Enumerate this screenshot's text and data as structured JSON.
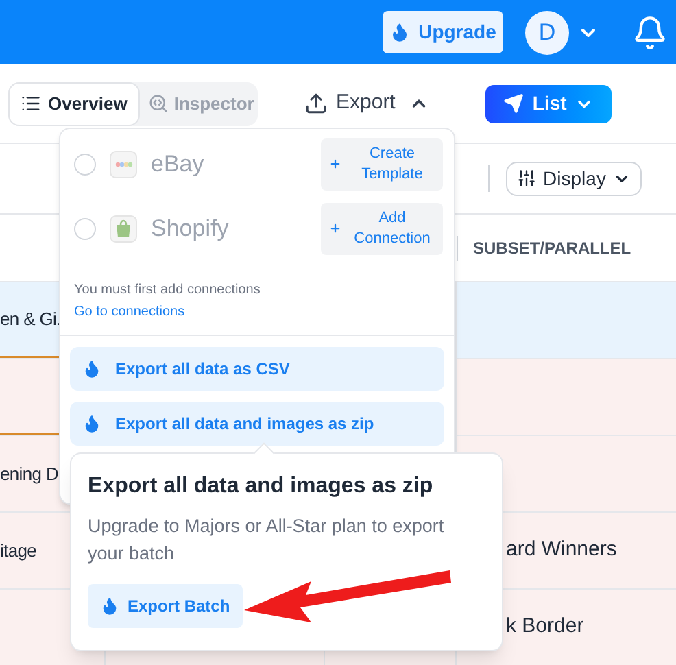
{
  "top_bar": {
    "upgrade": "Upgrade",
    "avatar": "D"
  },
  "view_tabs": [
    {
      "label": "Overview",
      "selected": true
    },
    {
      "label": "Inspector",
      "selected": false
    }
  ],
  "export_label": "Export",
  "list_button": "List",
  "display_button": "Display",
  "table": {
    "header": "SUBSET/PARALLEL",
    "rows": [
      {
        "first": "en & Gi.",
        "selected": true
      },
      {
        "selected": false
      },
      {
        "first": "ening D",
        "selected": false
      },
      {
        "first": "itage",
        "last": "ard Winners",
        "selected": false
      },
      {
        "last": "k Border",
        "selected": false
      }
    ]
  },
  "export_menu": {
    "connections": [
      {
        "kind": "ebay",
        "name": "eBay",
        "checked": false,
        "action": "Create Template"
      },
      {
        "kind": "shopify",
        "name": "Shopify",
        "checked": false,
        "action": "Add Connection"
      }
    ],
    "note": "You must first add connections",
    "link": "Go to connections",
    "options": [
      "Export all data as CSV",
      "Export all data and images as zip"
    ]
  },
  "popover": {
    "title": "Export all data and images as zip",
    "text": "Upgrade to Majors or All-Star plan to export your batch",
    "button": "Export Batch"
  }
}
